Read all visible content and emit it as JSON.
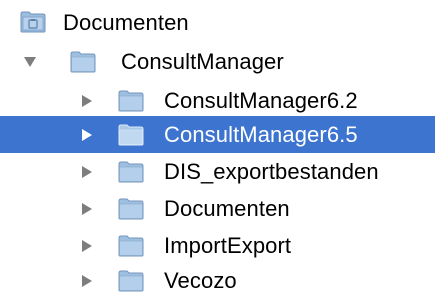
{
  "tree": {
    "root": {
      "label": "Documenten",
      "icon": "documents-folder-icon"
    },
    "folder": {
      "label": "ConsultManager",
      "icon": "folder-icon",
      "expanded": true
    },
    "children": [
      {
        "label": "ConsultManager6.2",
        "icon": "folder-icon",
        "selected": false
      },
      {
        "label": "ConsultManager6.5",
        "icon": "folder-icon",
        "selected": true
      },
      {
        "label": "DIS_exportbestanden",
        "icon": "folder-icon",
        "selected": false
      },
      {
        "label": "Documenten",
        "icon": "folder-icon",
        "selected": false
      },
      {
        "label": "ImportExport",
        "icon": "folder-icon",
        "selected": false
      },
      {
        "label": "Vecozo",
        "icon": "folder-icon",
        "selected": false
      }
    ]
  },
  "colors": {
    "selection": "#3d74d0",
    "folder": "#a9c7e6",
    "disclosure": "#7d7d7d"
  }
}
